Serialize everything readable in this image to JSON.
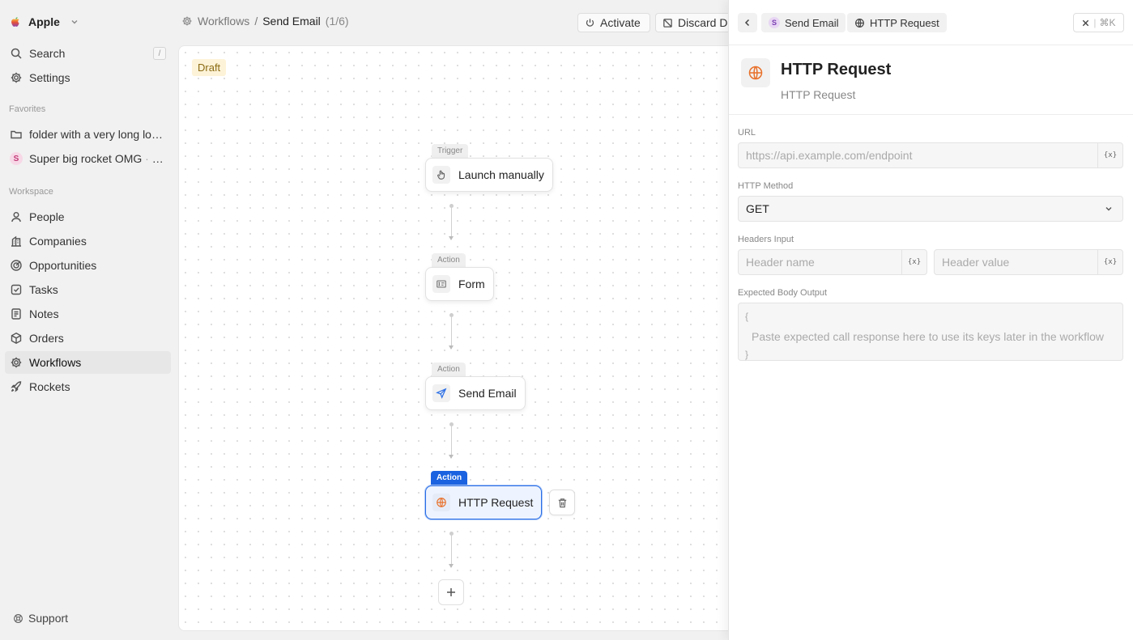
{
  "workspace": {
    "name": "Apple"
  },
  "nav_top": [
    {
      "id": "search",
      "label": "Search",
      "shortcut": "/"
    },
    {
      "id": "settings",
      "label": "Settings"
    }
  ],
  "favorites": {
    "label": "Favorites",
    "items": [
      {
        "label": "folder with a very long long long name"
      },
      {
        "label": "Super big rocket OMG",
        "suffix": "· Rockets",
        "avatar": "S"
      }
    ]
  },
  "workspace_section": {
    "label": "Workspace",
    "items": [
      {
        "label": "People"
      },
      {
        "label": "Companies"
      },
      {
        "label": "Opportunities"
      },
      {
        "label": "Tasks"
      },
      {
        "label": "Notes"
      },
      {
        "label": "Orders"
      },
      {
        "label": "Workflows",
        "active": true
      },
      {
        "label": "Rockets"
      }
    ]
  },
  "support": {
    "label": "Support"
  },
  "breadcrumb": {
    "root": "Workflows",
    "separator": "/",
    "current": "Send Email",
    "count": "(1/6)"
  },
  "toolbar": {
    "activate_label": "Activate",
    "discard_label": "Discard Draft"
  },
  "canvas": {
    "status_badge": "Draft",
    "nodes": [
      {
        "tag": "Trigger",
        "label": "Launch manually",
        "icon": "hand-pointer-icon"
      },
      {
        "tag": "Action",
        "label": "Form",
        "icon": "form-icon"
      },
      {
        "tag": "Action",
        "label": "Send Email",
        "icon": "send-icon"
      },
      {
        "tag": "Action",
        "label": "HTTP Request",
        "icon": "globe-icon",
        "selected": true
      }
    ]
  },
  "panel": {
    "crumbs": [
      {
        "label": "Send Email",
        "avatar": "S"
      },
      {
        "label": "HTTP Request"
      }
    ],
    "close_shortcut": "⌘K",
    "title": "HTTP Request",
    "subtitle": "HTTP Request",
    "url": {
      "label": "URL",
      "placeholder": "https://api.example.com/endpoint"
    },
    "method": {
      "label": "HTTP Method",
      "value": "GET"
    },
    "headers": {
      "label": "Headers Input",
      "name_placeholder": "Header name",
      "value_placeholder": "Header value"
    },
    "body": {
      "label": "Expected Body Output",
      "line1": "{",
      "line2": "Paste expected call response here to use its keys later in the workflow",
      "line3": "}"
    },
    "variable_glyph": "{x}"
  },
  "colors": {
    "accent": "#1a62e0",
    "http_icon": "#e8702a",
    "send_icon": "#2a6ee6",
    "draft_bg": "#fdf3d8"
  }
}
